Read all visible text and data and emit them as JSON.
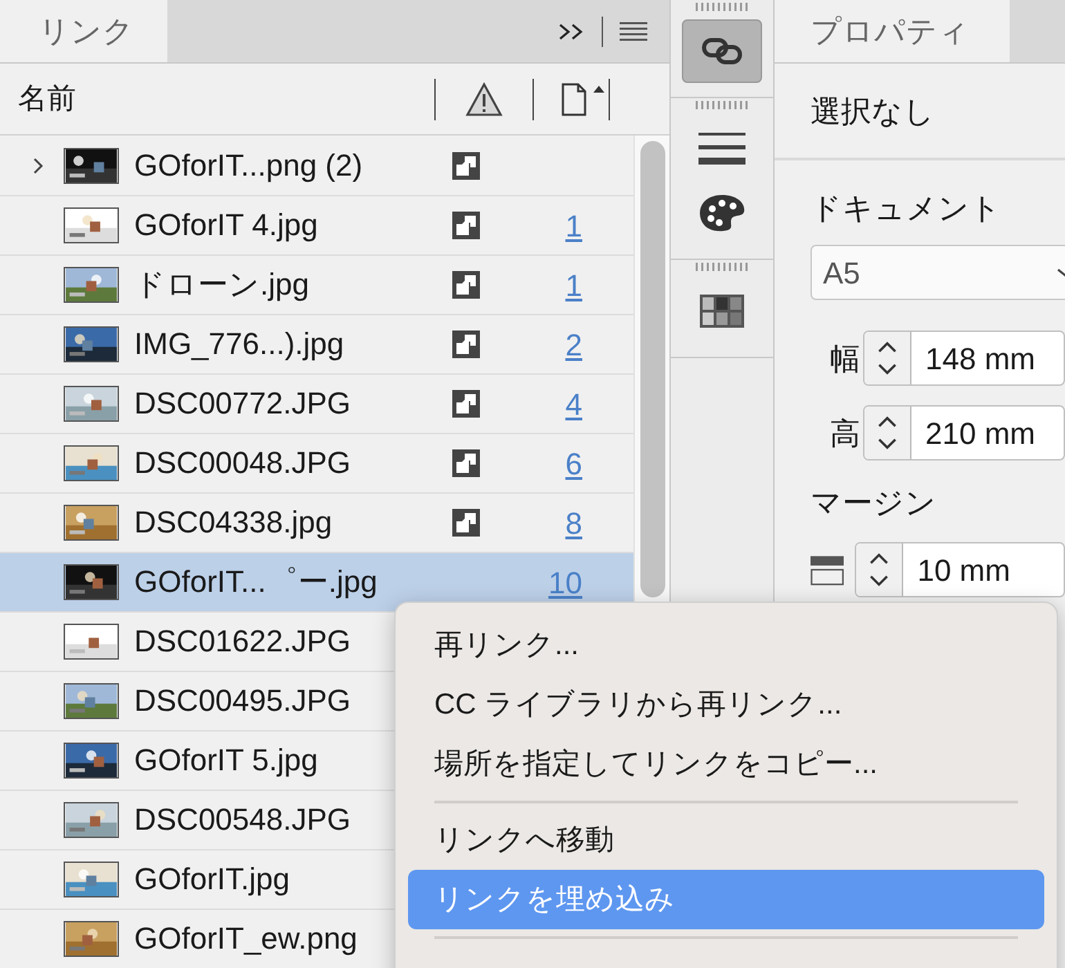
{
  "links_panel": {
    "tab": {
      "label": "リンク",
      "selected": true
    },
    "columns": {
      "name": "名前"
    },
    "rows": [
      {
        "name": "GOforIT...png (2)",
        "expanded": false,
        "status_icon": true,
        "count": "",
        "selected": false
      },
      {
        "name": "GOforIT 4.jpg",
        "status_icon": true,
        "count": "1",
        "selected": false
      },
      {
        "name": "ドローン.jpg",
        "status_icon": true,
        "count": "1",
        "selected": false
      },
      {
        "name": "IMG_776...).jpg",
        "status_icon": true,
        "count": "2",
        "selected": false
      },
      {
        "name": "DSC00772.JPG",
        "status_icon": true,
        "count": "4",
        "selected": false
      },
      {
        "name": "DSC00048.JPG",
        "status_icon": true,
        "count": "6",
        "selected": false
      },
      {
        "name": "DSC04338.jpg",
        "status_icon": true,
        "count": "8",
        "selected": false
      },
      {
        "name": "GOforIT...゜ー.jpg",
        "count": "10",
        "selected": true
      },
      {
        "name": "DSC01622.JPG",
        "count": "",
        "selected": false
      },
      {
        "name": "DSC00495.JPG",
        "count": "",
        "selected": false
      },
      {
        "name": "GOforIT 5.jpg",
        "count": "",
        "selected": false
      },
      {
        "name": "DSC00548.JPG",
        "count": "",
        "selected": false
      },
      {
        "name": "GOforIT.jpg",
        "count": "",
        "selected": false
      },
      {
        "name": "GOforIT_ew.png",
        "count": "",
        "selected": false
      }
    ]
  },
  "tool_strip": [
    {
      "kind": "link",
      "selected": true
    },
    {
      "kind": "stroke",
      "selected": false
    },
    {
      "kind": "palette",
      "selected": false
    },
    {
      "kind": "swatches",
      "selected": false
    }
  ],
  "properties_panel": {
    "tab": {
      "label": "プロパティ",
      "selected": true
    },
    "selection": "選択なし",
    "section": "ドキュメント",
    "preset": "A5",
    "fields": [
      {
        "label": "幅",
        "value": "148 mm"
      },
      {
        "label": "高",
        "value": "210 mm"
      }
    ],
    "margin_title": "マージン",
    "margin_value": "10 mm"
  },
  "context_menu": {
    "items": [
      {
        "kind": "item",
        "label": "再リンク...",
        "selected": false
      },
      {
        "kind": "item",
        "label": "CC ライブラリから再リンク...",
        "selected": false
      },
      {
        "kind": "item",
        "label": "場所を指定してリンクをコピー...",
        "selected": false
      },
      {
        "kind": "separator"
      },
      {
        "kind": "item",
        "label": "リンクへ移動",
        "selected": false
      },
      {
        "kind": "item",
        "label": "リンクを埋め込み",
        "selected": true
      },
      {
        "kind": "separator"
      }
    ]
  }
}
